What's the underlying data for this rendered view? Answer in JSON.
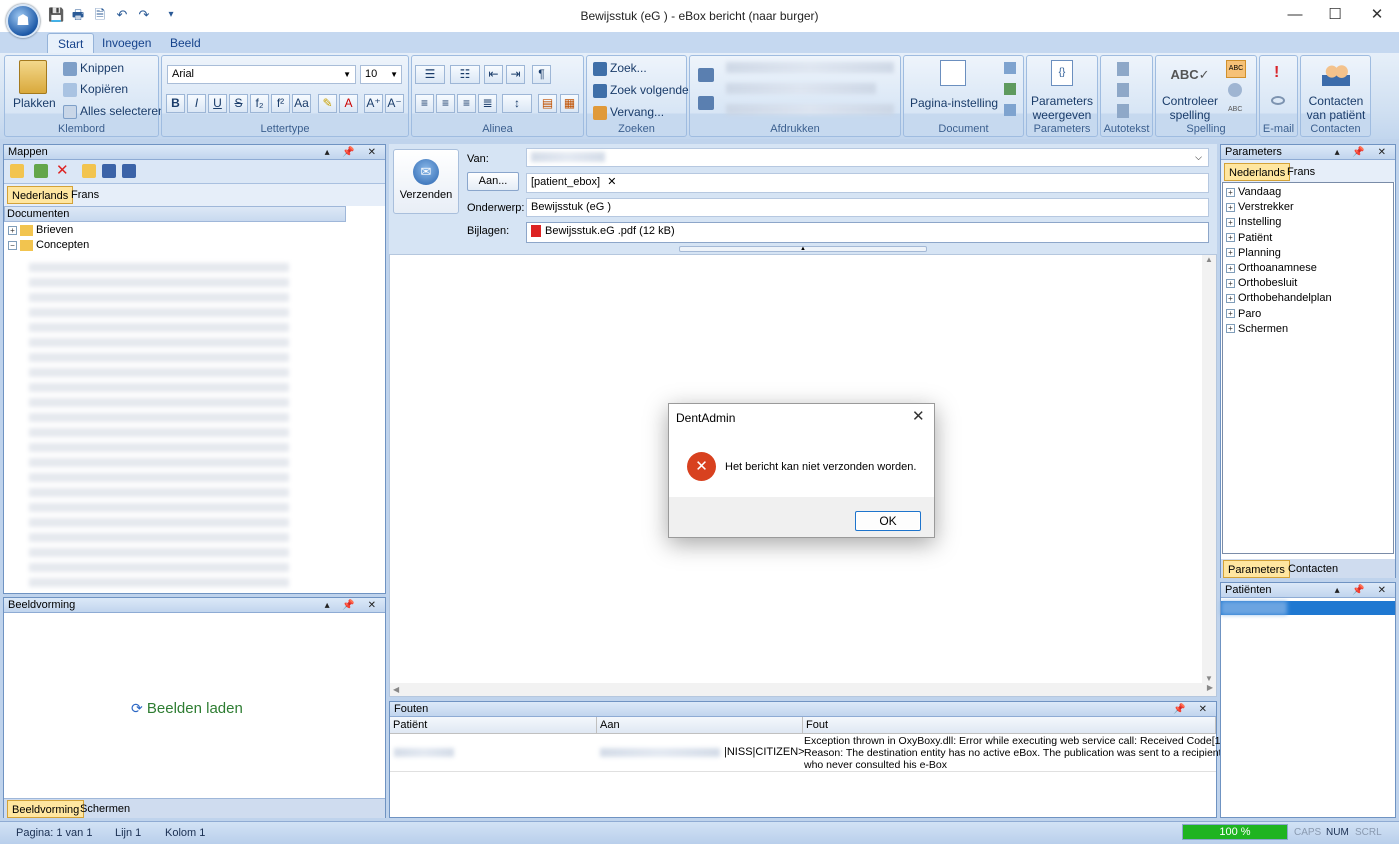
{
  "window": {
    "title": "Bewijsstuk (eG        ) - eBox bericht (naar burger)",
    "minimize": "—",
    "maximize": "☐",
    "close": "✕"
  },
  "quick_access": [
    "💾",
    "🖶",
    "🗎",
    "↶",
    "↷",
    "▾"
  ],
  "tabs": [
    "Start",
    "Invoegen",
    "Beeld"
  ],
  "ribbon": {
    "klembord": {
      "label": "Klembord",
      "paste": "Plakken",
      "cut": "Knippen",
      "copy": "Kopiëren",
      "select_all": "Alles selecteren"
    },
    "lettertype": {
      "label": "Lettertype",
      "font": "Arial",
      "size": "10"
    },
    "alinea": {
      "label": "Alinea"
    },
    "zoeken": {
      "label": "Zoeken",
      "find": "Zoek...",
      "find_next": "Zoek volgende",
      "replace": "Vervang..."
    },
    "afdrukken": {
      "label": "Afdrukken"
    },
    "document": {
      "label": "Document",
      "page_setup": "Pagina-instelling"
    },
    "parameters": {
      "label": "Parameters",
      "show_params_1": "Parameters",
      "show_params_2": "weergeven"
    },
    "autotekst": {
      "label": "Autotekst"
    },
    "spelling": {
      "label": "Spelling",
      "check_1": "Controleer",
      "check_2": "spelling"
    },
    "email": {
      "label": "E-mail"
    },
    "contacten": {
      "label": "Contacten",
      "contacts_1": "Contacten",
      "contacts_2": "van patiënt"
    }
  },
  "left": {
    "mappen": {
      "title": "Mappen",
      "tabs": [
        "Nederlands",
        "Frans"
      ],
      "header": "Documenten",
      "items": [
        "Brieven",
        "Concepten"
      ]
    },
    "beeldvorming": {
      "title": "Beeldvorming",
      "load": "Beelden laden",
      "tabs": [
        "Beeldvorming",
        "Schermen"
      ]
    }
  },
  "compose": {
    "send": "Verzenden",
    "van_label": "Van:",
    "aan_button": "Aan...",
    "aan_value": "[patient_ebox]",
    "subject_label": "Onderwerp:",
    "subject_value": "Bewijsstuk (eG         )",
    "attach_label": "Bijlagen:",
    "attach_value": "Bewijsstuk.eG          .pdf (12 kB)"
  },
  "errors": {
    "title": "Fouten",
    "columns": [
      "Patiënt",
      "Aan",
      "Fout"
    ],
    "row": {
      "aan_suffix": "|NISS|CITIZEN>",
      "fout_1": "Exception thrown in OxyBoxy.dll: Error while executing web service call: Received Code[101]",
      "fout_2": "Reason:  The destination entity has no active eBox. The publication was sent to a recipient",
      "fout_3": "who never consulted his e-Box"
    }
  },
  "right": {
    "parameters": {
      "title": "Parameters",
      "tabs": [
        "Nederlands",
        "Frans"
      ],
      "items": [
        "Vandaag",
        "Verstrekker",
        "Instelling",
        "Patiënt",
        "Planning",
        "Orthoanamnese",
        "Orthobesluit",
        "Orthobehandelplan",
        "Paro",
        "Schermen"
      ],
      "bottom_tabs": [
        "Parameters",
        "Contacten"
      ]
    },
    "patienten": {
      "title": "Patiënten"
    }
  },
  "dialog": {
    "title": "DentAdmin",
    "message": "Het bericht kan niet verzonden worden.",
    "ok": "OK"
  },
  "status": {
    "page": "Pagina: 1 van 1",
    "line": "Lijn 1",
    "col": "Kolom 1",
    "zoom": "100 %",
    "zoom_fraction": 1.0,
    "caps": "CAPS",
    "num": "NUM",
    "scrl": "SCRL"
  }
}
